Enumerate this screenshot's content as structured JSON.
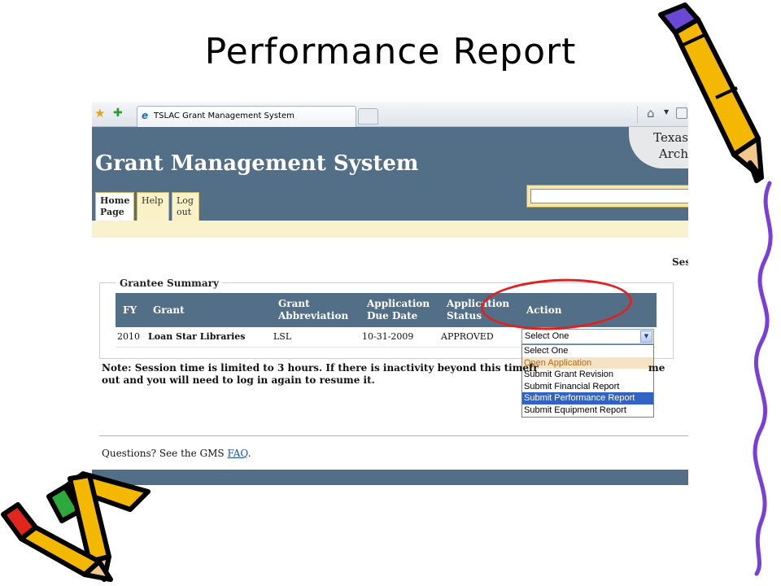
{
  "slide": {
    "title": "Performance Report"
  },
  "browser": {
    "tab_title": "TSLAC Grant Management System"
  },
  "header": {
    "agency_line1": "Texas",
    "agency_line2": "Arch",
    "app_title": "Grant Management System",
    "search_value": ""
  },
  "nav": {
    "home_line1": "Home",
    "home_line2": "Page",
    "help": "Help",
    "logout_line1": "Log",
    "logout_line2": "out"
  },
  "session_label": "Ses",
  "grantee_summary": {
    "legend": "Grantee Summary",
    "columns": {
      "fy": "FY",
      "grant": "Grant",
      "abbr_line1": "Grant",
      "abbr_line2": "Abbreviation",
      "due_line1": "Application",
      "due_line2": "Due Date",
      "status_line1": "Application",
      "status_line2": "Status",
      "action": "Action"
    },
    "row": {
      "fy": "2010",
      "grant": "Loan Star Libraries",
      "abbreviation": "LSL",
      "due_date": "10-31-2009",
      "status": "APPROVED",
      "action_selected": "Select One"
    },
    "action_options": [
      "Select One",
      "Open Application",
      "Submit Grant Revision",
      "Submit Financial Report",
      "Submit Performance Report",
      "Submit Equipment Report"
    ]
  },
  "note": {
    "line1": "Note: Session time is limited to 3 hours. If there is inactivity beyond this timefr",
    "line1_tail": "me",
    "line2": "out and you will need to log in again to resume it."
  },
  "footer": {
    "questions_text": "Questions? See the GMS",
    "faq_link": "FAQ",
    "period": "."
  },
  "colors": {
    "header_blue": "#536f88",
    "nav_yellow": "#fbf1c6",
    "highlight_circle": "#e0211f",
    "selected_option": "#3163c5"
  },
  "icons": [
    "star-icon",
    "add-favorite-icon",
    "ie-icon",
    "home-icon",
    "feed-icon",
    "chevron-down-icon",
    "pencil-icon"
  ]
}
